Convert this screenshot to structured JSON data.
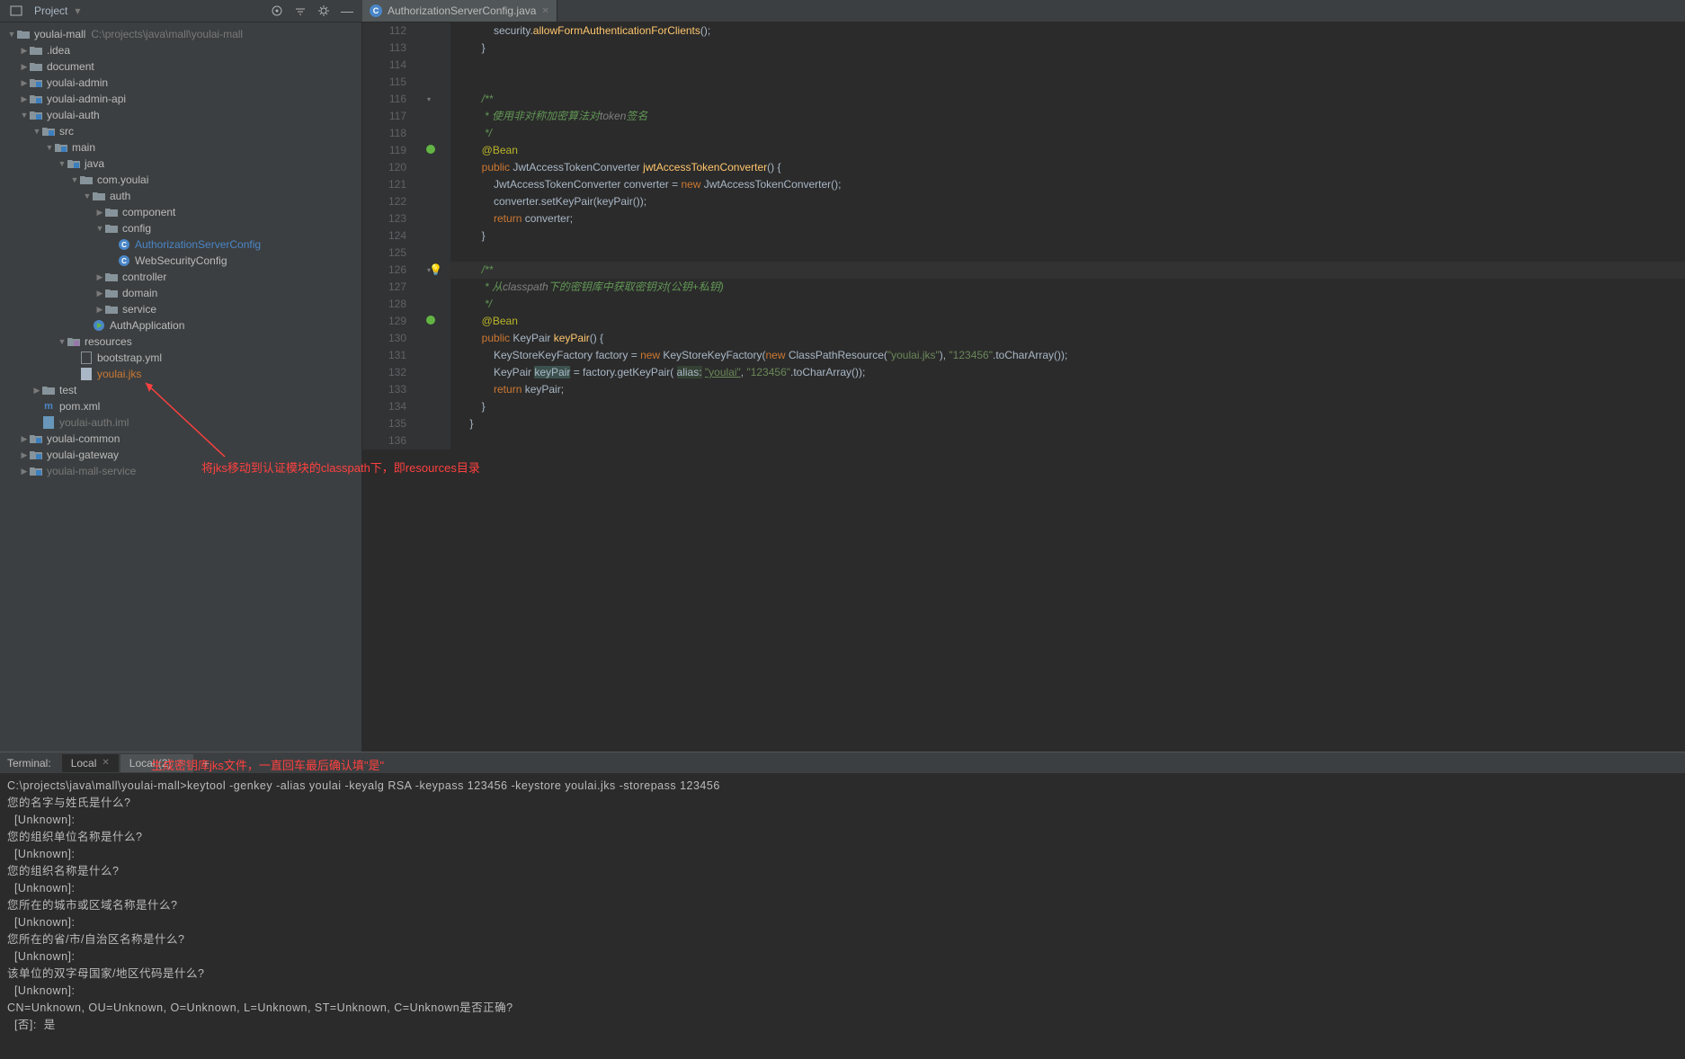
{
  "topbar": {
    "title": "Project",
    "tab_name": "AuthorizationServerConfig.java"
  },
  "project_root": {
    "name": "youlai-mall",
    "path": "C:\\projects\\java\\mall\\youlai-mall"
  },
  "tree": [
    {
      "d": 0,
      "c": "▼",
      "ic": "folder-root",
      "t": "youlai-mall",
      "suf": "C:\\projects\\java\\mall\\youlai-mall"
    },
    {
      "d": 1,
      "c": "▶",
      "ic": "folder",
      "t": ".idea"
    },
    {
      "d": 1,
      "c": "▶",
      "ic": "folder",
      "t": "document"
    },
    {
      "d": 1,
      "c": "▶",
      "ic": "folder-blue",
      "t": "youlai-admin"
    },
    {
      "d": 1,
      "c": "▶",
      "ic": "folder-blue",
      "t": "youlai-admin-api"
    },
    {
      "d": 1,
      "c": "▼",
      "ic": "folder-blue",
      "t": "youlai-auth"
    },
    {
      "d": 2,
      "c": "▼",
      "ic": "folder-blue",
      "t": "src"
    },
    {
      "d": 3,
      "c": "▼",
      "ic": "folder-blue",
      "t": "main"
    },
    {
      "d": 4,
      "c": "▼",
      "ic": "folder-blue",
      "t": "java"
    },
    {
      "d": 5,
      "c": "▼",
      "ic": "folder",
      "t": "com.youlai"
    },
    {
      "d": 6,
      "c": "▼",
      "ic": "folder",
      "t": "auth"
    },
    {
      "d": 7,
      "c": "▶",
      "ic": "folder",
      "t": "component"
    },
    {
      "d": 7,
      "c": "▼",
      "ic": "folder",
      "t": "config"
    },
    {
      "d": 8,
      "c": "",
      "ic": "class",
      "t": "AuthorizationServerConfig",
      "sel": true
    },
    {
      "d": 8,
      "c": "",
      "ic": "class",
      "t": "WebSecurityConfig"
    },
    {
      "d": 7,
      "c": "▶",
      "ic": "folder",
      "t": "controller"
    },
    {
      "d": 7,
      "c": "▶",
      "ic": "folder",
      "t": "domain"
    },
    {
      "d": 7,
      "c": "▶",
      "ic": "folder",
      "t": "service"
    },
    {
      "d": 6,
      "c": "",
      "ic": "app",
      "t": "AuthApplication"
    },
    {
      "d": 4,
      "c": "▼",
      "ic": "folder-res",
      "t": "resources"
    },
    {
      "d": 5,
      "c": "",
      "ic": "yml",
      "t": "bootstrap.yml"
    },
    {
      "d": 5,
      "c": "",
      "ic": "file",
      "t": "youlai.jks",
      "orange": true
    },
    {
      "d": 2,
      "c": "▶",
      "ic": "folder",
      "t": "test"
    },
    {
      "d": 2,
      "c": "",
      "ic": "maven",
      "t": "pom.xml"
    },
    {
      "d": 2,
      "c": "",
      "ic": "iml",
      "t": "youlai-auth.iml",
      "dim": true
    },
    {
      "d": 1,
      "c": "▶",
      "ic": "folder-blue",
      "t": "youlai-common"
    },
    {
      "d": 1,
      "c": "▶",
      "ic": "folder-blue",
      "t": "youlai-gateway"
    },
    {
      "d": 1,
      "c": "▶",
      "ic": "folder-blue",
      "t": "youlai-mall-service",
      "dim": true
    }
  ],
  "code": {
    "start": 112,
    "lines": [
      {
        "html": "            security.<span class='fn'>allowFormAuthenticationForClients</span>();"
      },
      {
        "html": "        }"
      },
      {
        "html": " "
      },
      {
        "html": " "
      },
      {
        "html": "        <span class='cmt'>/**</span>",
        "fold": "fold"
      },
      {
        "html": "         <span class='cmt'>* 使用非对称加密算法对</span><span class='cmt-i'>token</span><span class='cmt'>签名</span>"
      },
      {
        "html": "         <span class='cmt'>*/</span>"
      },
      {
        "html": "        <span class='ann'>@Bean</span>",
        "gic": "bean"
      },
      {
        "html": "        <span class='kw'>public</span> JwtAccessTokenConverter <span class='fn'>jwtAccessTokenConverter</span>() {"
      },
      {
        "html": "            JwtAccessTokenConverter converter = <span class='kw'>new</span> JwtAccessTokenConverter();"
      },
      {
        "html": "            converter.setKeyPair(keyPair());"
      },
      {
        "html": "            <span class='kw'>return</span> converter;"
      },
      {
        "html": "        }"
      },
      {
        "html": " "
      },
      {
        "html": "        <span class='cmt'>/**</span>",
        "hl": true,
        "bulb": true,
        "fold": "fold"
      },
      {
        "html": "         <span class='cmt'>* 从</span><span class='cmt-i'>classpath</span><span class='cmt'>下的密钥库中获取密钥对(公钥+私钥)</span>"
      },
      {
        "html": "         <span class='cmt'>*/</span>"
      },
      {
        "html": "        <span class='ann'>@Bean</span>",
        "gic": "bean"
      },
      {
        "html": "        <span class='kw'>public</span> KeyPair <span class='fn'>keyPair</span>() {"
      },
      {
        "html": "            KeyStoreKeyFactory factory = <span class='kw'>new</span> KeyStoreKeyFactory(<span class='kw'>new</span> ClassPathResource(<span class='str'>\"youlai.jks\"</span>), <span class='str'>\"123456\"</span>.toCharArray());"
      },
      {
        "html": "            KeyPair <span class='hl-bg'>keyPair</span> = factory.getKeyPair( <span class='param'>alias:</span> <span class='str underline'>\"youlai\"</span>, <span class='str'>\"123456\"</span>.toCharArray());"
      },
      {
        "html": "            <span class='kw'>return</span> keyPair;"
      },
      {
        "html": "        }"
      },
      {
        "html": "    }"
      },
      {
        "html": " "
      }
    ]
  },
  "terminal": {
    "label": "Terminal:",
    "tabs": [
      {
        "t": "Local",
        "active": false
      },
      {
        "t": "Local (2)",
        "active": true
      }
    ],
    "lines": [
      "C:\\projects\\java\\mall\\youlai-mall>keytool -genkey -alias youlai -keyalg RSA -keypass 123456 -keystore youlai.jks -storepass 123456",
      "您的名字与姓氏是什么?",
      "  [Unknown]:",
      "您的组织单位名称是什么?",
      "  [Unknown]:",
      "您的组织名称是什么?",
      "  [Unknown]:",
      "您所在的城市或区域名称是什么?",
      "  [Unknown]:",
      "您所在的省/市/自治区名称是什么?",
      "  [Unknown]:",
      "该单位的双字母国家/地区代码是什么?",
      "  [Unknown]:",
      "CN=Unknown, OU=Unknown, O=Unknown, L=Unknown, ST=Unknown, C=Unknown是否正确?",
      "  [否]:  是"
    ]
  },
  "annotations": {
    "a1": "将jks移动到认证模块的classpath下，即resources目录",
    "a2": "生成密钥库jks文件，一直回车最后确认填\"是\""
  }
}
